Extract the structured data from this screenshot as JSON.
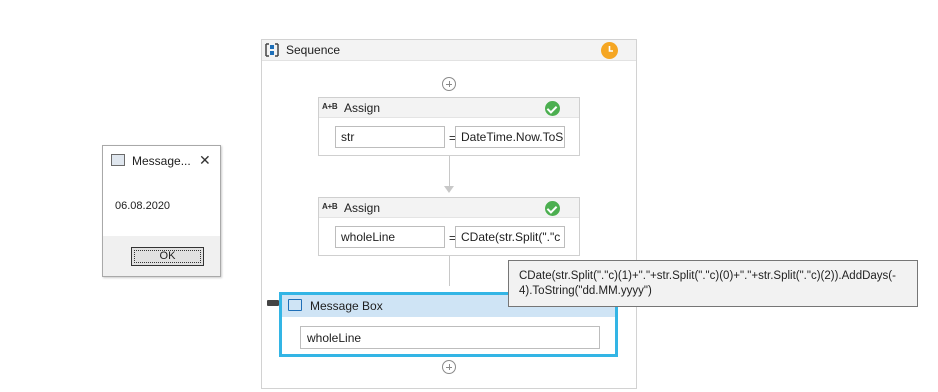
{
  "sequence": {
    "title": "Sequence"
  },
  "assign1": {
    "title": "Assign",
    "left_value": "str",
    "equals": "=",
    "right_value": "DateTime.Now.ToS"
  },
  "assign2": {
    "title": "Assign",
    "left_value": "wholeLine",
    "equals": "=",
    "right_value": "CDate(str.Split(\".\"c"
  },
  "message_activity": {
    "title": "Message Box",
    "value": "wholeLine"
  },
  "tooltip": {
    "text": "CDate(str.Split(\".\"c)(1)+\".\"+str.Split(\".\"c)(0)+\".\"+str.Split(\".\"c)(2)).AddDays(-4).ToString(\"dd.MM.yyyy\")"
  },
  "dialog": {
    "title": "Message...",
    "close_glyph": "✕",
    "message": "06.08.2020",
    "ok_label": "OK"
  },
  "icons": {
    "assign_icon_text": "A+B"
  },
  "colors": {
    "accent": "#33b5e5",
    "success": "#4caf50",
    "warning": "#f5a623",
    "header_blue": "#cfe4f5"
  }
}
